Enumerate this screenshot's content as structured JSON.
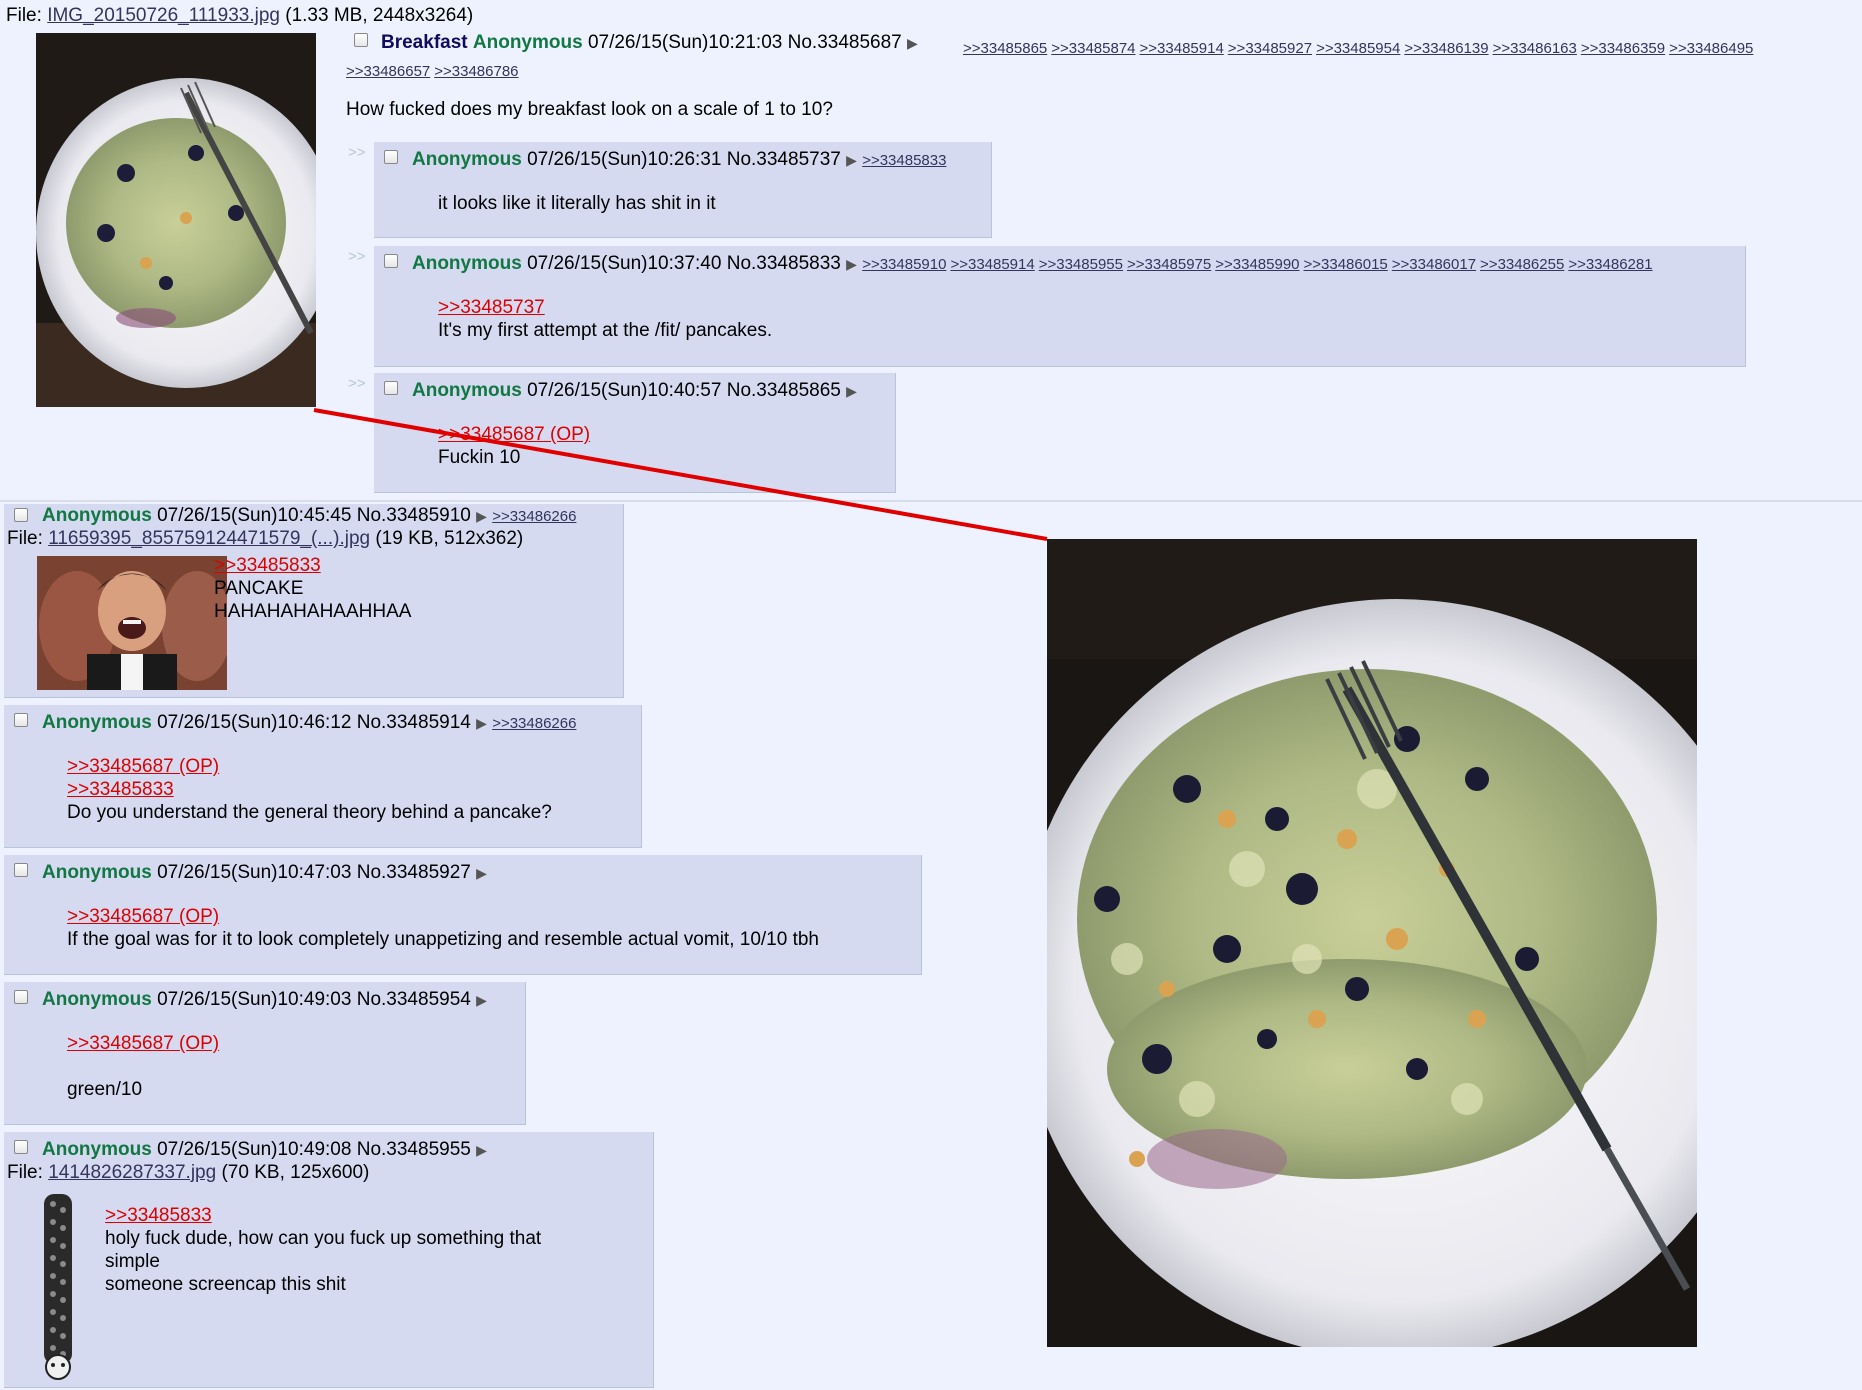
{
  "op": {
    "file_label": "File:",
    "file_name": "IMG_20150726_111933.jpg",
    "file_meta": "(1.33 MB, 2448x3264)",
    "subject": "Breakfast",
    "name": "Anonymous",
    "datetime": "07/26/15(Sun)10:21:03",
    "number": "No.33485687",
    "backlinks_line1": [
      ">>33485865",
      ">>33485874",
      ">>33485914",
      ">>33485927",
      ">>33485954",
      ">>33486139",
      ">>33486163",
      ">>33486359",
      ">>33486495"
    ],
    "backlinks_line2": [
      ">>33486657",
      ">>33486786"
    ],
    "message": "How fucked does my breakfast look on a scale of 1 to 10?"
  },
  "ui": {
    "arrow": "▶",
    "side_arrow": ">>",
    "file_label": "File:"
  },
  "replies": [
    {
      "name": "Anonymous",
      "datetime": "07/26/15(Sun)10:26:31",
      "number": "No.33485737",
      "backlinks": [
        ">>33485833"
      ],
      "message": "it looks like it literally has shit in it"
    },
    {
      "name": "Anonymous",
      "datetime": "07/26/15(Sun)10:37:40",
      "number": "No.33485833",
      "backlinks": [
        ">>33485910",
        ">>33485914",
        ">>33485955",
        ">>33485975",
        ">>33485990",
        ">>33486015",
        ">>33486017",
        ">>33486255",
        ">>33486281"
      ],
      "quote": ">>33485737",
      "message": "It's my first attempt at the /fit/ pancakes."
    },
    {
      "name": "Anonymous",
      "datetime": "07/26/15(Sun)10:40:57",
      "number": "No.33485865",
      "quote": ">>33485687 (OP)",
      "message": "Fuckin 10"
    },
    {
      "name": "Anonymous",
      "datetime": "07/26/15(Sun)10:45:45",
      "number": "No.33485910",
      "backlinks": [
        ">>33486266"
      ],
      "file_name": "11659395_855759124471579_(...).jpg",
      "file_meta": "(19 KB, 512x362)",
      "quote": ">>33485833",
      "message_lines": [
        "PANCAKE",
        "HAHAHAHAHAAHHAA"
      ]
    },
    {
      "name": "Anonymous",
      "datetime": "07/26/15(Sun)10:46:12",
      "number": "No.33485914",
      "backlinks": [
        ">>33486266"
      ],
      "quotes": [
        ">>33485687 (OP)",
        ">>33485833"
      ],
      "message": "Do you understand the general theory behind a pancake?"
    },
    {
      "name": "Anonymous",
      "datetime": "07/26/15(Sun)10:47:03",
      "number": "No.33485927",
      "quote": ">>33485687 (OP)",
      "message": "If the goal was for it to look completely unappetizing and resemble actual vomit, 10/10 tbh"
    },
    {
      "name": "Anonymous",
      "datetime": "07/26/15(Sun)10:49:03",
      "number": "No.33485954",
      "quote": ">>33485687 (OP)",
      "message": "green/10"
    },
    {
      "name": "Anonymous",
      "datetime": "07/26/15(Sun)10:49:08",
      "number": "No.33485955",
      "file_name": "1414826287337.jpg",
      "file_meta": "(70 KB, 125x600)",
      "quote": ">>33485833",
      "message_lines": [
        "holy fuck dude, how can you fuck up something that",
        "simple",
        "someone screencap this shit"
      ]
    }
  ],
  "colors": {
    "page_bg": "#eef2ff",
    "reply_bg": "#d6daf0",
    "name": "#117743",
    "subject": "#0f0c5d",
    "quotelink": "#dd0000",
    "annotation_line": "#e00000"
  },
  "images": {
    "op_thumb": "photo of scrambled blue-green pancake on white plate with fork",
    "reaction_thumb": "laughing man reaction image",
    "tall_thumb": "tall stacked repeated laughing faces image",
    "enlarged": "enlarged photo of the pancake plate"
  }
}
